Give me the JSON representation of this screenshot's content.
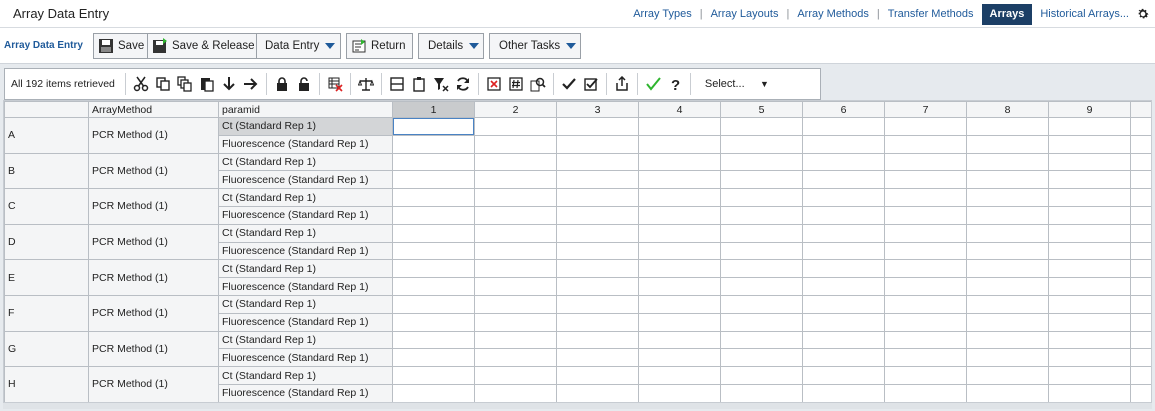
{
  "window": {
    "title": "Array Data Entry"
  },
  "topnav": {
    "links": [
      "Array Types",
      "Array Layouts",
      "Array Methods",
      "Transfer Methods",
      "Arrays",
      "Historical Arrays..."
    ],
    "active": "Arrays",
    "separator": "|"
  },
  "actionbar": {
    "label": "Array Data Entry",
    "save": "Save",
    "save_release": "Save & Release",
    "data_entry": "Data Entry",
    "return": "Return",
    "details": "Details",
    "other_tasks": "Other Tasks"
  },
  "toolbar": {
    "count": "All 192 items retrieved",
    "select": "Select...",
    "icons": [
      "cut-icon",
      "copy-icon",
      "copy-multiple-icon",
      "paste-icon",
      "arrow-down-icon",
      "arrow-right-icon",
      "lock-icon",
      "unlock-icon",
      "clear-cells-icon",
      "balance-icon",
      "split-view-icon",
      "clipboard-icon",
      "filter-clear-icon",
      "refresh-icon",
      "delete-cell-icon",
      "hash-icon",
      "find-icon",
      "check-icon",
      "checkbox-icon",
      "export-icon",
      "green-check-icon",
      "help-icon"
    ]
  },
  "grid": {
    "headers": {
      "row": "",
      "method": "ArrayMethod",
      "param": "paramid"
    },
    "columns": [
      "1",
      "2",
      "3",
      "4",
      "5",
      "6",
      "7",
      "8",
      "9"
    ],
    "rows": [
      {
        "label": "A",
        "method": "PCR Method (1)",
        "params": [
          "Ct (Standard Rep 1)",
          "Fluorescence (Standard Rep 1)"
        ]
      },
      {
        "label": "B",
        "method": "PCR Method (1)",
        "params": [
          "Ct (Standard Rep 1)",
          "Fluorescence (Standard Rep 1)"
        ]
      },
      {
        "label": "C",
        "method": "PCR Method (1)",
        "params": [
          "Ct (Standard Rep 1)",
          "Fluorescence (Standard Rep 1)"
        ]
      },
      {
        "label": "D",
        "method": "PCR Method (1)",
        "params": [
          "Ct (Standard Rep 1)",
          "Fluorescence (Standard Rep 1)"
        ]
      },
      {
        "label": "E",
        "method": "PCR Method (1)",
        "params": [
          "Ct (Standard Rep 1)",
          "Fluorescence (Standard Rep 1)"
        ]
      },
      {
        "label": "F",
        "method": "PCR Method (1)",
        "params": [
          "Ct (Standard Rep 1)",
          "Fluorescence (Standard Rep 1)"
        ]
      },
      {
        "label": "G",
        "method": "PCR Method (1)",
        "params": [
          "Ct (Standard Rep 1)",
          "Fluorescence (Standard Rep 1)"
        ]
      },
      {
        "label": "H",
        "method": "PCR Method (1)",
        "params": [
          "Ct (Standard Rep 1)",
          "Fluorescence (Standard Rep 1)"
        ]
      }
    ]
  },
  "colors": {
    "accent": "#1f5a9a",
    "active_nav": "#1c3f66",
    "check_green": "#2fb52f"
  }
}
